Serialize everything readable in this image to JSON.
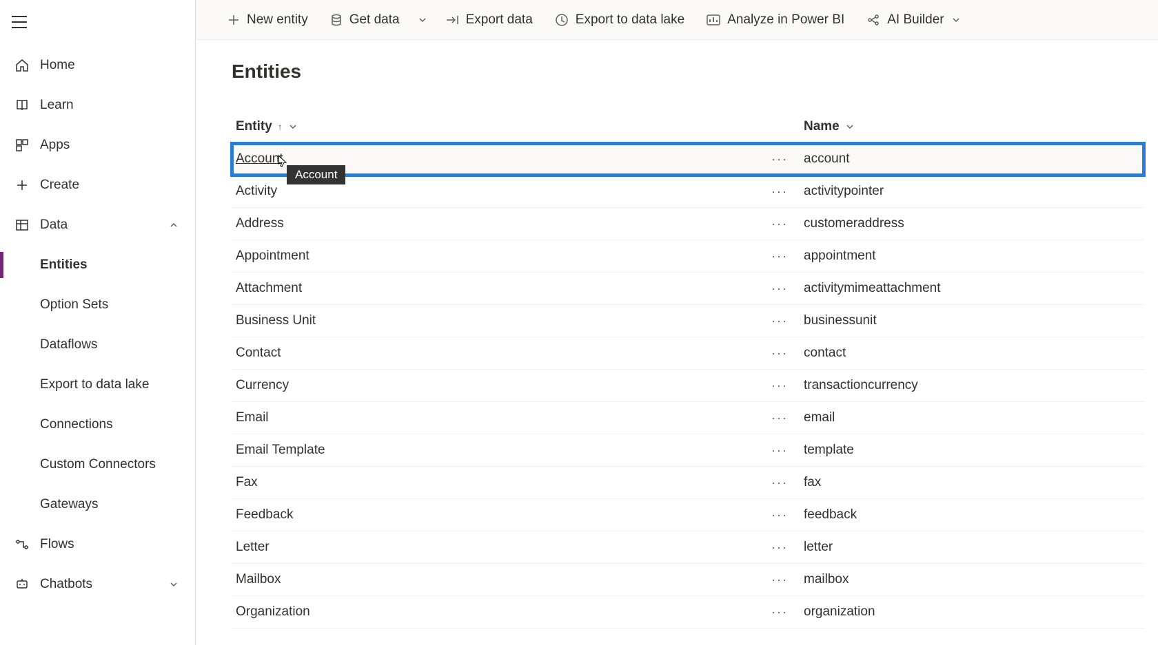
{
  "sidebar": {
    "items": [
      {
        "label": "Home"
      },
      {
        "label": "Learn"
      },
      {
        "label": "Apps"
      },
      {
        "label": "Create"
      },
      {
        "label": "Data"
      }
    ],
    "data_children": [
      {
        "label": "Entities"
      },
      {
        "label": "Option Sets"
      },
      {
        "label": "Dataflows"
      },
      {
        "label": "Export to data lake"
      },
      {
        "label": "Connections"
      },
      {
        "label": "Custom Connectors"
      },
      {
        "label": "Gateways"
      }
    ],
    "flows_label": "Flows",
    "chatbots_label": "Chatbots"
  },
  "commands": {
    "new_entity": "New entity",
    "get_data": "Get data",
    "export_data": "Export data",
    "export_lake": "Export to data lake",
    "analyze": "Analyze in Power BI",
    "ai_builder": "AI Builder"
  },
  "page": {
    "title": "Entities",
    "col_entity": "Entity",
    "col_name": "Name"
  },
  "tooltip": "Account",
  "rows": [
    {
      "entity": "Account",
      "name": "account"
    },
    {
      "entity": "Activity",
      "name": "activitypointer"
    },
    {
      "entity": "Address",
      "name": "customeraddress"
    },
    {
      "entity": "Appointment",
      "name": "appointment"
    },
    {
      "entity": "Attachment",
      "name": "activitymimeattachment"
    },
    {
      "entity": "Business Unit",
      "name": "businessunit"
    },
    {
      "entity": "Contact",
      "name": "contact"
    },
    {
      "entity": "Currency",
      "name": "transactioncurrency"
    },
    {
      "entity": "Email",
      "name": "email"
    },
    {
      "entity": "Email Template",
      "name": "template"
    },
    {
      "entity": "Fax",
      "name": "fax"
    },
    {
      "entity": "Feedback",
      "name": "feedback"
    },
    {
      "entity": "Letter",
      "name": "letter"
    },
    {
      "entity": "Mailbox",
      "name": "mailbox"
    },
    {
      "entity": "Organization",
      "name": "organization"
    }
  ]
}
